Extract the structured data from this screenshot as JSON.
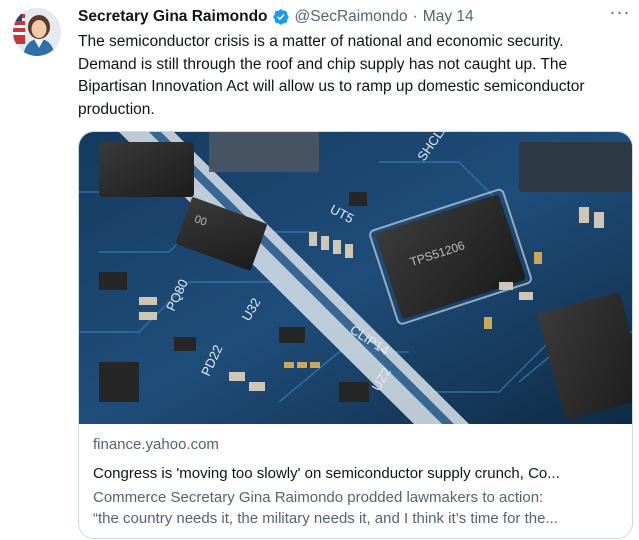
{
  "tweet": {
    "author_name": "Secretary Gina Raimondo",
    "handle": "@SecRaimondo",
    "separator": "·",
    "date": "May 14",
    "more_label": "···",
    "text_lines": [
      "The semiconductor crisis is a matter of national and economic security.",
      "Demand is still through the roof and chip supply has not caught up. The",
      "Bipartisan Innovation Act will allow us to ramp up domestic semiconductor",
      "production."
    ]
  },
  "card": {
    "domain": "finance.yahoo.com",
    "title": "Congress is 'moving too slowly' on semiconductor supply crunch, Co...",
    "description_lines": [
      "Commerce Secretary Gina Raimondo prodded lawmakers to action:",
      "“the country needs it, the military needs it, and I think it’s time for the..."
    ],
    "image_labels": {
      "chip_center": "TPS51206",
      "chip_left": "00",
      "board_ut5": "UT5",
      "board_clip": "CLIP14",
      "board_u32": "U32",
      "board_pq": "PQ80",
      "board_pd": "PD22",
      "board_sh": "SHCLA",
      "board_uz": "UZ2"
    }
  },
  "colors": {
    "verified": "#1d9bf0",
    "secondary_text": "#536471",
    "border": "#cfd9de",
    "pcb_blue": "#1f4d7a"
  }
}
